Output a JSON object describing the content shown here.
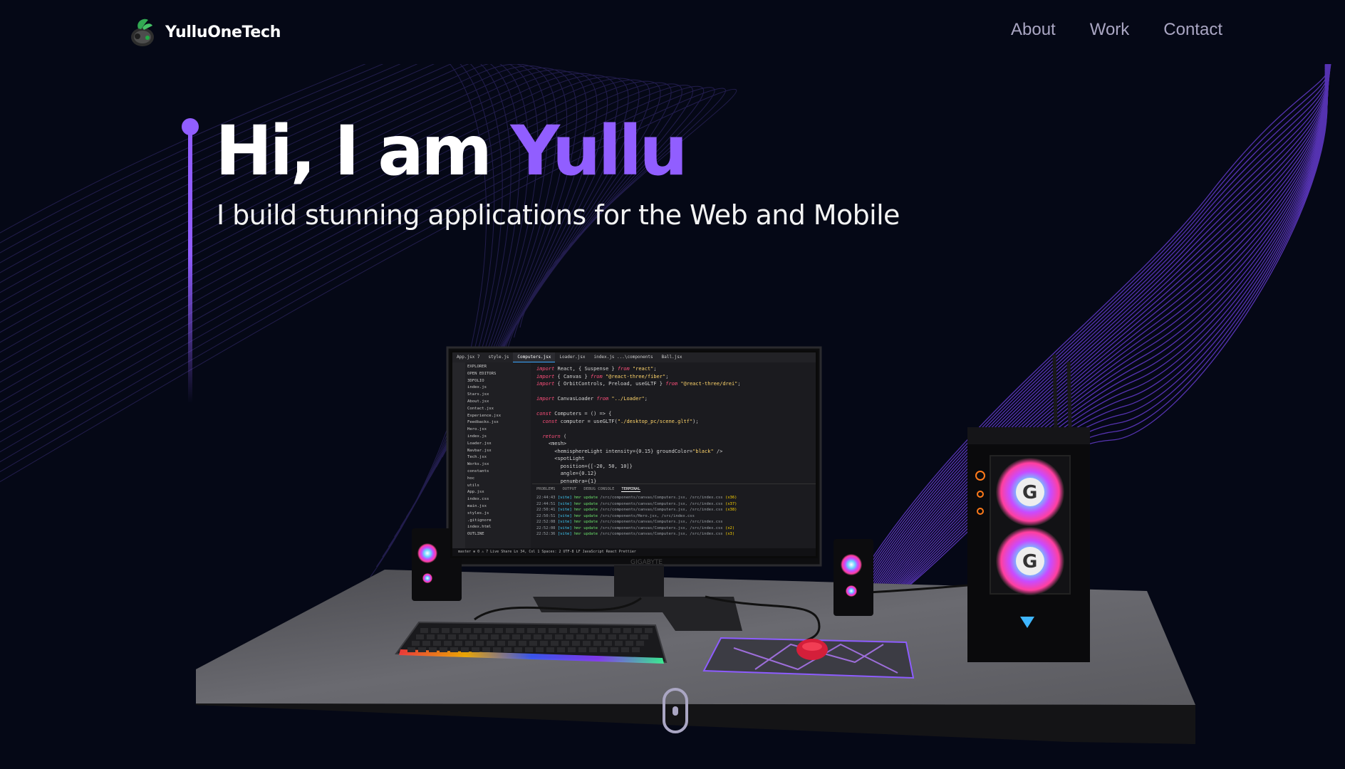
{
  "brand": {
    "name": "YulluOneTech",
    "logo_icon": "frog-logo-icon"
  },
  "nav": {
    "links": [
      "About",
      "Work",
      "Contact"
    ]
  },
  "hero": {
    "greeting": "Hi, I am ",
    "name": "Yullu",
    "subtitle": "I build stunning applications for the Web and Mobile"
  },
  "ide": {
    "tabs": [
      "App.jsx 7",
      "style.js",
      "Computers.jsx",
      "Loader.jsx",
      "index.js ...\\components",
      "Ball.jsx"
    ],
    "files": [
      "EXPLORER",
      "OPEN EDITORS",
      "3DFOLIO",
      "index.js",
      "Stars.jsx",
      "About.jsx",
      "Contact.jsx",
      "Experience.jsx",
      "Feedbacks.jsx",
      "Hero.jsx",
      "index.js",
      "Loader.jsx",
      "Navbar.jsx",
      "Tech.jsx",
      "Works.jsx",
      "constants",
      "hoc",
      "utils",
      "App.jsx",
      "index.css",
      "main.jsx",
      "styles.js",
      ".gitignore",
      "index.html",
      "OUTLINE"
    ],
    "code": [
      "import React, { Suspense } from \"react\";",
      "import { Canvas } from \"@react-three/fiber\";",
      "import { OrbitControls, Preload, useGLTF } from \"@react-three/drei\";",
      "",
      "import CanvasLoader from \"../Loader\";",
      "",
      "const Computers = () => {",
      "  const computer = useGLTF(\"./desktop_pc/scene.gltf\");",
      "",
      "  return (",
      "    <mesh>",
      "      <hemisphereLight intensity={0.15} groundColor=\"black\" />",
      "      <spotLight",
      "        position={[-20, 50, 10]}",
      "        angle={0.12}",
      "        penumbra={1}"
    ],
    "terminal_tabs": [
      "PROBLEMS",
      "OUTPUT",
      "DEBUG CONSOLE",
      "TERMINAL"
    ],
    "terminal": [
      "22:44:43 [vite] hmr update /src/components/canvas/Computers.jsx, /src/index.css (x36)",
      "22:44:51 [vite] hmr update /src/components/canvas/Computers.jsx, /src/index.css (x37)",
      "22:50:41 [vite] hmr update /src/components/canvas/Computers.jsx, /src/index.css (x38)",
      "22:50:51 [vite] hmr update /src/components/Hero.jsx, /src/index.css",
      "22:52:08 [vite] hmr update /src/components/canvas/Computers.jsx, /src/index.css",
      "22:52:08 [vite] hmr update /src/components/canvas/Computers.jsx, /src/index.css (x2)",
      "22:52:36 [vite] hmr update /src/components/canvas/Computers.jsx, /src/index.css (x3)"
    ],
    "status": "master  ⊗ 0 ⚠ 7  Live Share          Ln 34, Col 1  Spaces: 2  UTF-8  LF  JavaScript React  Prettier"
  },
  "colors": {
    "background": "#050816",
    "accent": "#915eff",
    "nav_text": "#aaa6c3"
  }
}
